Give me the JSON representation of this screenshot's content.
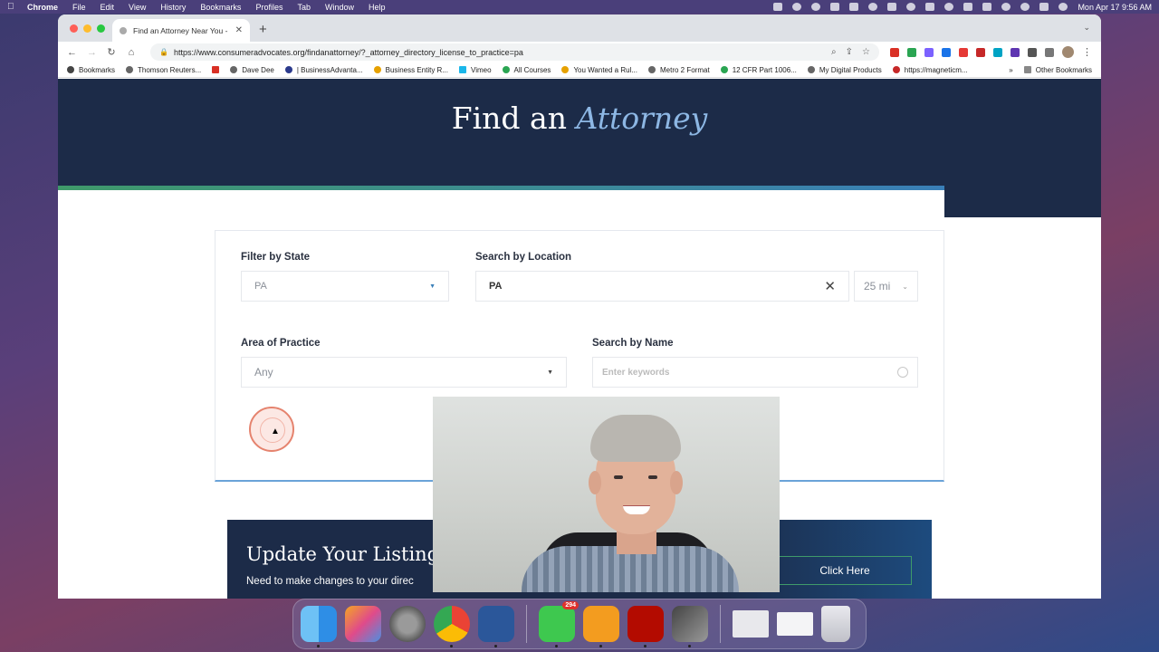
{
  "menubar": {
    "app": "Chrome",
    "items": [
      "File",
      "Edit",
      "View",
      "History",
      "Bookmarks",
      "Profiles",
      "Tab",
      "Window",
      "Help"
    ],
    "clock": "Mon Apr 17  9:56 AM"
  },
  "browser": {
    "tab_title": "Find an Attorney Near You - N…",
    "url": "https://www.consumeradvocates.org/findanattorney/?_attorney_directory_license_to_practice=pa",
    "bookmarks": [
      "Bookmarks",
      "Thomson Reuters...",
      "Dave Dee",
      "| BusinessAdvanta...",
      "Business Entity R...",
      "Vimeo",
      "All Courses",
      "You Wanted a Rul...",
      "Metro 2 Format",
      "12 CFR Part 1006...",
      "My Digital Products",
      "https://magneticm..."
    ],
    "bookmarks_overflow": "»",
    "other_bookmarks": "Other Bookmarks"
  },
  "hero": {
    "title_plain": "Find an",
    "title_accent": "Attorney"
  },
  "filters": {
    "state_label": "Filter by State",
    "state_value": "PA",
    "location_label": "Search by Location",
    "location_value": "PA",
    "radius_value": "25 mi",
    "practice_label": "Area of Practice",
    "practice_value": "Any",
    "name_label": "Search by Name",
    "name_placeholder": "Enter keywords"
  },
  "update": {
    "title": "Update Your Listing",
    "subtitle": "Need to make changes to your direc",
    "button": "Click Here"
  },
  "dock": {
    "messages_badge": "294"
  },
  "colors": {
    "navy": "#1c2b48",
    "accent_blue": "#8db7e4",
    "green": "#3f9a6a"
  }
}
